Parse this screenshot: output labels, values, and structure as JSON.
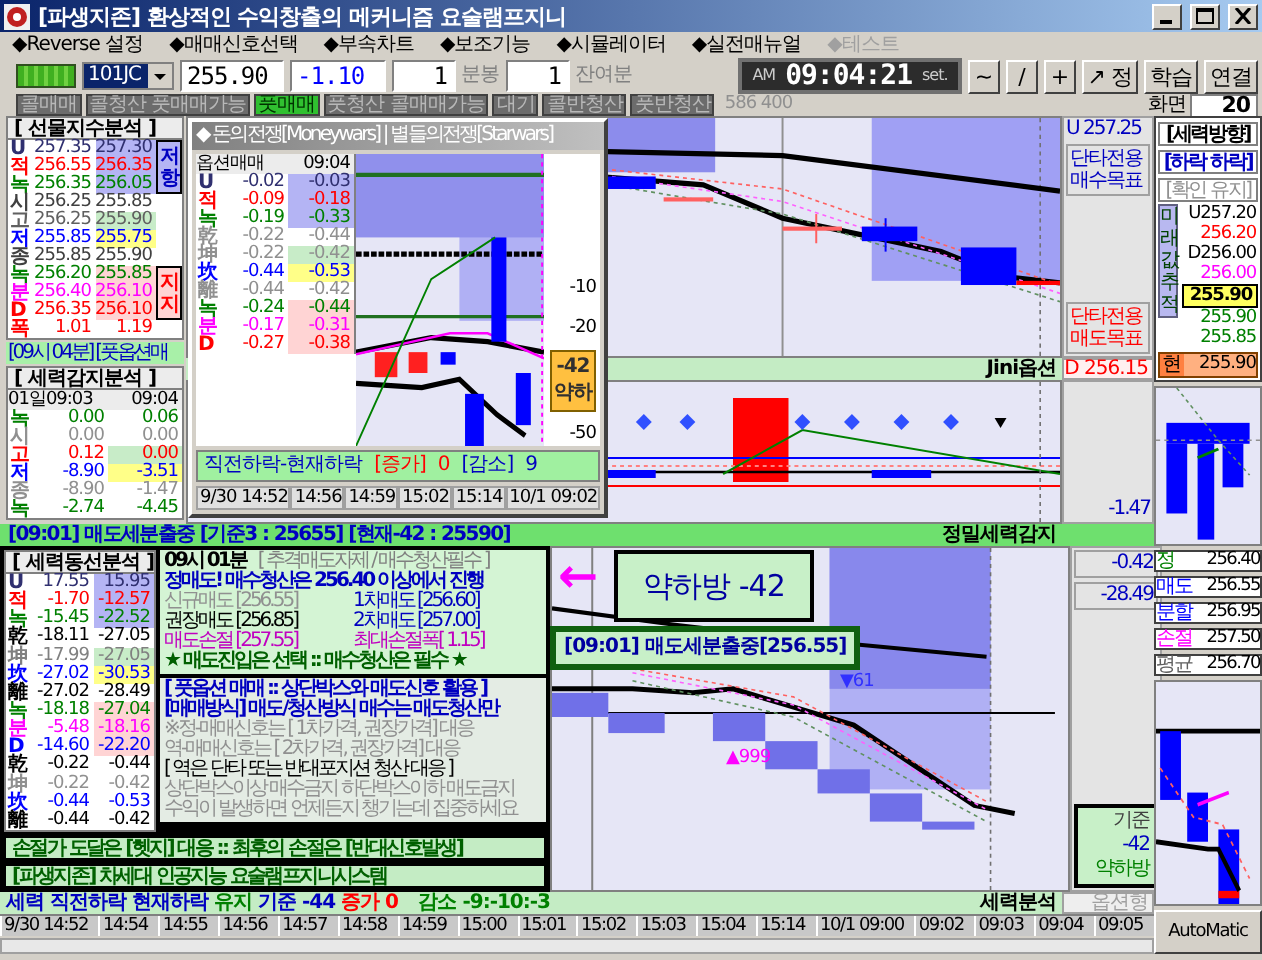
{
  "window": {
    "title": "[파생지존] 환상적인 수익창출의 메커니즘 요술램프지니"
  },
  "menu": [
    {
      "label": "◆Reverse 설정",
      "disabled": false
    },
    {
      "label": "◆매매신호선택",
      "disabled": false
    },
    {
      "label": "◆부속차트",
      "disabled": false
    },
    {
      "label": "◆보조기능",
      "disabled": false
    },
    {
      "label": "◆시뮬레이터",
      "disabled": false
    },
    {
      "label": "◆실전매뉴얼",
      "disabled": false
    },
    {
      "label": "◆테스트",
      "disabled": true
    }
  ],
  "toolbar": {
    "code": "101JC",
    "price": "255.90",
    "change": "-1.10",
    "interval": "1",
    "interval_unit": "분봉",
    "remaining": "1",
    "remaining_unit": "잔여분",
    "clock": {
      "meridiem": "AM",
      "time": "09:04:21",
      "set_label": "set."
    },
    "buttons": [
      "~",
      "/",
      "+",
      "↗ 정",
      "학습",
      "연결"
    ]
  },
  "signals": [
    {
      "label": "콜매매",
      "selected": false
    },
    {
      "label": "콜청산 풋매매가능",
      "selected": false
    },
    {
      "label": "풋매매",
      "selected": true
    },
    {
      "label": "풋청산 콜매매가능",
      "selected": false
    },
    {
      "label": "대기",
      "selected": false
    },
    {
      "label": "콜반청산",
      "selected": false
    },
    {
      "label": "풋반청산",
      "selected": false
    }
  ],
  "signal_count": "586 400",
  "screen": {
    "label": "화면",
    "value": "20"
  },
  "futures_panel": {
    "title": "[ 선물지수분석 ]",
    "side_labels": [
      {
        "text": "저항",
        "kind": "resist"
      },
      {
        "text": "지지",
        "kind": "support"
      }
    ],
    "rows": [
      {
        "label": "U",
        "values": [
          "257.35",
          "257.30"
        ],
        "color": "#303070",
        "kind": "resist"
      },
      {
        "label": "적",
        "values": [
          "256.55",
          "256.35"
        ],
        "color": "#ff0000",
        "kind": "resist"
      },
      {
        "label": "녹",
        "values": [
          "256.35",
          "256.05"
        ],
        "color": "#008000",
        "kind": "resist"
      },
      {
        "label": "시",
        "values": [
          "256.25",
          "255.85"
        ],
        "color": "#404040",
        "kind": "plain"
      },
      {
        "label": "고",
        "values": [
          "256.25",
          "255.90"
        ],
        "color": "#606060",
        "kind": "hold"
      },
      {
        "label": "저",
        "values": [
          "255.85",
          "255.75"
        ],
        "color": "#0000ff",
        "kind": "focus"
      },
      {
        "label": "종",
        "values": [
          "255.85",
          "255.90"
        ],
        "color": "#404040",
        "kind": "plain"
      },
      {
        "label": "녹",
        "values": [
          "256.20",
          "255.85"
        ],
        "color": "#008000",
        "kind": "support"
      },
      {
        "label": "분",
        "values": [
          "256.40",
          "256.10"
        ],
        "color": "#ff00ff",
        "kind": "support"
      },
      {
        "label": "D",
        "values": [
          "256.35",
          "256.10"
        ],
        "color": "#ff0000",
        "kind": "support"
      },
      {
        "label": "폭",
        "values": [
          "1.01",
          "1.19"
        ],
        "color": "#ff0000",
        "kind": "plain"
      }
    ]
  },
  "futures_note": "[09시 04분] [풋옵션매",
  "power_panel": {
    "title": "[ 세력감지분석 ]",
    "columns": [
      "01일09:03",
      "09:04"
    ],
    "rows": [
      {
        "label": "녹",
        "values": [
          "0.00",
          "0.06"
        ],
        "color": "#008000",
        "kind": "plain"
      },
      {
        "label": "시",
        "values": [
          "0.00",
          "0.00"
        ],
        "color": "#909090",
        "kind": "plain"
      },
      {
        "label": "고",
        "values": [
          "0.12",
          "0.00"
        ],
        "color": "#ff0000",
        "kind": "hold"
      },
      {
        "label": "저",
        "values": [
          "-8.90",
          "-3.51"
        ],
        "color": "#0000ff",
        "kind": "focus"
      },
      {
        "label": "종",
        "values": [
          "-8.90",
          "-1.47"
        ],
        "color": "#909090",
        "kind": "plain"
      },
      {
        "label": "녹",
        "values": [
          "-2.74",
          "-4.45"
        ],
        "color": "#008000",
        "kind": "plain"
      }
    ]
  },
  "price_chart": {
    "buy_price": "U 257.25",
    "buy_label": "단타전용 매수목표",
    "sell_label": "단타전용 매도목표",
    "sell_price": "D 256.15",
    "strip": "Jini옵션",
    "indicator_reading": "-1.47"
  },
  "ticker": {
    "text": "[09:01] 매도세분출중 [기준3 : 25655] [현재-42 : 25590]",
    "strip": "정밀세력감지"
  },
  "flow_panel": {
    "title": "[ 세력동선분석 ]",
    "rows": [
      {
        "label": "U",
        "values": [
          "17.55",
          "15.95"
        ],
        "color": "#303070",
        "kind": "resist"
      },
      {
        "label": "적",
        "values": [
          "-1.70",
          "-12.57"
        ],
        "color": "#ff0000",
        "kind": "resist"
      },
      {
        "label": "녹",
        "values": [
          "-15.45",
          "-22.52"
        ],
        "color": "#008000",
        "kind": "resist"
      },
      {
        "label": "乾",
        "values": [
          "-18.11",
          "-27.05"
        ],
        "color": "#000000",
        "kind": "plain"
      },
      {
        "label": "坤",
        "values": [
          "-17.99",
          "-27.05"
        ],
        "color": "#808080",
        "kind": "hold"
      },
      {
        "label": "坎",
        "values": [
          "-27.02",
          "-30.53"
        ],
        "color": "#0000ff",
        "kind": "focus"
      },
      {
        "label": "離",
        "values": [
          "-27.02",
          "-28.49"
        ],
        "color": "#000000",
        "kind": "plain"
      },
      {
        "label": "녹",
        "values": [
          "-18.18",
          "-27.04"
        ],
        "color": "#008000",
        "kind": "support"
      },
      {
        "label": "분",
        "values": [
          "-5.48",
          "-18.16"
        ],
        "color": "#ff00ff",
        "kind": "support"
      },
      {
        "label": "D",
        "values": [
          "-14.60",
          "-22.20"
        ],
        "color": "#0000ff",
        "kind": "support"
      },
      {
        "label": "乾",
        "values": [
          "-0.22",
          "-0.44"
        ],
        "color": "#000000",
        "kind": "plain"
      },
      {
        "label": "坤",
        "values": [
          "-0.22",
          "-0.42"
        ],
        "color": "#909090",
        "kind": "plain"
      },
      {
        "label": "坎",
        "values": [
          "-0.44",
          "-0.53"
        ],
        "color": "#0000ff",
        "kind": "plain"
      },
      {
        "label": "離",
        "values": [
          "-0.44",
          "-0.42"
        ],
        "color": "#000000",
        "kind": "plain"
      }
    ]
  },
  "signal_panel": {
    "time": "09시 01분",
    "headline": "[ 추격매도자제 / 매수청산필수 ]",
    "alert": "정매도! 매수청산은 256.40 이상에서 진행",
    "orders": [
      {
        "text": "신규매도 [256.55]",
        "kind": "muted"
      },
      {
        "text": "1차매도 [256.60]",
        "kind": "entry"
      },
      {
        "text": "권장매도 [256.85]",
        "kind": "plain"
      },
      {
        "text": "2차매도 [257.00]",
        "kind": "entry"
      },
      {
        "text": "매도손절 [257.55]",
        "kind": "stop"
      },
      {
        "text": "최대손절폭[ 1.15]",
        "kind": "stop"
      }
    ],
    "motto": "★ 매도진입은 선택 :: 매수청산은 필수 ★",
    "rules": [
      {
        "text": "[ 풋옵션 매매 :: 상단박스와 매도신호 활용 ]",
        "kind": "title"
      },
      {
        "text": "[매매방식] 매도/청산방식 매수는 매도청산만",
        "kind": "title"
      },
      {
        "text": "※정-매매신호는 [ 1차가격, 권장가격] 대응",
        "kind": "muted"
      },
      {
        "text": "역-매매신호는 [ 2차가격, 권장가격] 대응",
        "kind": "muted"
      },
      {
        "text": "[ 역은 단타 또는 반대포지션 청산 대응 ]",
        "kind": "plain"
      },
      {
        "text": "상단박스이상 매수금지  하단박스이하 매도금지",
        "kind": "muted"
      },
      {
        "text": "수익이 발생하면 언제든지 챙기는데 집중하세요",
        "kind": "muted"
      }
    ],
    "footers": [
      "손절가 도달은 [헷지] 대응 :: 최후의 손절은 [반대신호발생]",
      "[파생지존] 차세대 인공지능 요술램프지니시스템"
    ]
  },
  "chart_overlay": {
    "arrow": "←",
    "callout": "약하방 -42",
    "alert": "[09:01] 매도세분출중[256.55]",
    "marks": [
      {
        "text": "▼61",
        "kind": "sell"
      },
      {
        "text": "▲999",
        "kind": "buy"
      }
    ],
    "readings": [
      "-0.42",
      "-28.49"
    ],
    "basis": {
      "label": "기준",
      "value": "-42",
      "state": "약하방"
    },
    "strip": "세력분석",
    "strip_note": "옵션형"
  },
  "status_line": [
    {
      "text": "세력",
      "kind": "label"
    },
    {
      "text": "직전하락",
      "kind": "label"
    },
    {
      "text": "현재하락",
      "kind": "label"
    },
    {
      "text": "유지",
      "kind": "keep"
    },
    {
      "text": "기준 -44",
      "kind": "label"
    },
    {
      "text": "증가 0",
      "kind": "rise"
    },
    {
      "text": "감소 -9:-10:-3",
      "kind": "keep"
    }
  ],
  "time_axis": [
    "9/30 14:52",
    "14:54",
    "14:55",
    "14:56",
    "14:57",
    "14:58",
    "14:59",
    "15:00",
    "15:01",
    "15:02",
    "15:03",
    "15:04",
    "15:14",
    "10/1 09:00",
    "09:02",
    "09:03",
    "09:04",
    "09:05"
  ],
  "direction_panel": {
    "title": "[세력방향]",
    "state": "[하락 하락]",
    "confirm": "[확인 유지]",
    "track_label": "미래값추적",
    "levels": [
      {
        "text": "U257.20",
        "color": "#000000",
        "current": false
      },
      {
        "text": "256.20",
        "color": "#ff0000",
        "current": false
      },
      {
        "text": "D256.00",
        "color": "#000000",
        "current": false
      },
      {
        "text": "256.00",
        "color": "#ff00ff",
        "current": false
      },
      {
        "text": "255.90",
        "color": "#000000",
        "current": true
      },
      {
        "text": "255.90",
        "color": "#008000",
        "current": false
      },
      {
        "text": "255.85",
        "color": "#008000",
        "current": false
      }
    ],
    "current": {
      "label": "현",
      "value": "255.90"
    }
  },
  "trade_levels": [
    {
      "label": "정",
      "value": "256.40",
      "color": "#008000"
    },
    {
      "label": "매도",
      "value": "256.55",
      "color": "#0000ff"
    },
    {
      "label": "분할",
      "value": "256.95",
      "color": "#0000ff"
    },
    {
      "label": "손절",
      "value": "257.50",
      "color": "#ff00ff"
    },
    {
      "label": "평균",
      "value": "256.70",
      "color": "#606060"
    }
  ],
  "auto_button": "AutoMatic",
  "popup": {
    "title": "◆ 돈의전쟁[Moneywars] | 별들의전쟁[Starwars]",
    "columns": [
      "옵션매매",
      "09:04"
    ],
    "rows": [
      {
        "label": "U",
        "values": [
          "-0.02",
          "-0.03"
        ],
        "color": "#303070",
        "kind": "resist"
      },
      {
        "label": "적",
        "values": [
          "-0.09",
          "-0.18"
        ],
        "color": "#ff0000",
        "kind": "resist"
      },
      {
        "label": "녹",
        "values": [
          "-0.19",
          "-0.33"
        ],
        "color": "#008000",
        "kind": "resist"
      },
      {
        "label": "乾",
        "values": [
          "-0.22",
          "-0.44"
        ],
        "color": "#909090",
        "kind": "plain"
      },
      {
        "label": "坤",
        "values": [
          "-0.22",
          "-0.42"
        ],
        "color": "#909090",
        "kind": "hold"
      },
      {
        "label": "坎",
        "values": [
          "-0.44",
          "-0.53"
        ],
        "color": "#0000ff",
        "kind": "focus"
      },
      {
        "label": "離",
        "values": [
          "-0.44",
          "-0.42"
        ],
        "color": "#909090",
        "kind": "plain"
      },
      {
        "label": "녹",
        "values": [
          "-0.24",
          "-0.44"
        ],
        "color": "#008000",
        "kind": "support"
      },
      {
        "label": "분",
        "values": [
          "-0.17",
          "-0.31"
        ],
        "color": "#ff00ff",
        "kind": "support"
      },
      {
        "label": "D",
        "values": [
          "-0.27",
          "-0.38"
        ],
        "color": "#ff0000",
        "kind": "support"
      }
    ],
    "ticks": [
      "-10",
      "-20",
      "-50"
    ],
    "badge": {
      "value": "-42",
      "label": "약하"
    },
    "summary": {
      "label": "직전하락-현재하락",
      "rise_label": "[증가]",
      "rise": "0",
      "fall_label": "[감소]",
      "fall": "9"
    },
    "times": [
      "9/30 14:52",
      "14:56",
      "14:59",
      "15:02",
      "15:14",
      "10/1 09:02"
    ]
  }
}
